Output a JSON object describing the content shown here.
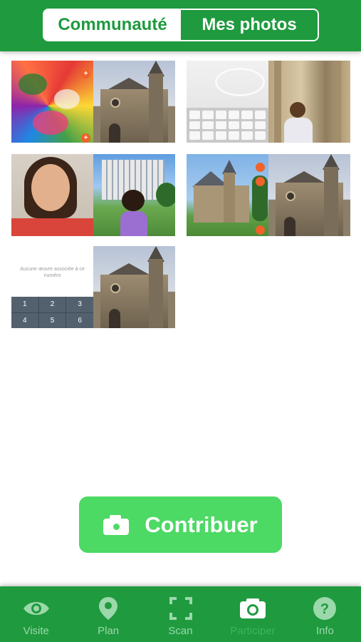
{
  "header": {
    "segments": [
      {
        "label": "Communauté",
        "selected": true
      },
      {
        "label": "Mes photos",
        "selected": false
      }
    ]
  },
  "photos": {
    "keypad_screen": {
      "message": "Aucune œuvre associée à ce numéro",
      "keys": [
        "1",
        "2",
        "3",
        "4",
        "5",
        "6"
      ]
    },
    "badges": [
      "+",
      "+"
    ]
  },
  "contribute": {
    "label": "Contribuer",
    "icon": "camera-icon",
    "color": "#4cd964"
  },
  "tabbar": {
    "items": [
      {
        "label": "Visite",
        "icon": "eye-icon"
      },
      {
        "label": "Plan",
        "icon": "map-pin-icon"
      },
      {
        "label": "Scan",
        "icon": "scan-icon"
      },
      {
        "label": "Participer",
        "icon": "camera-icon",
        "active": true
      },
      {
        "label": "Info",
        "icon": "help-icon"
      }
    ]
  },
  "colors": {
    "brand_green": "#1f9a3f",
    "button_green": "#4cd964"
  }
}
